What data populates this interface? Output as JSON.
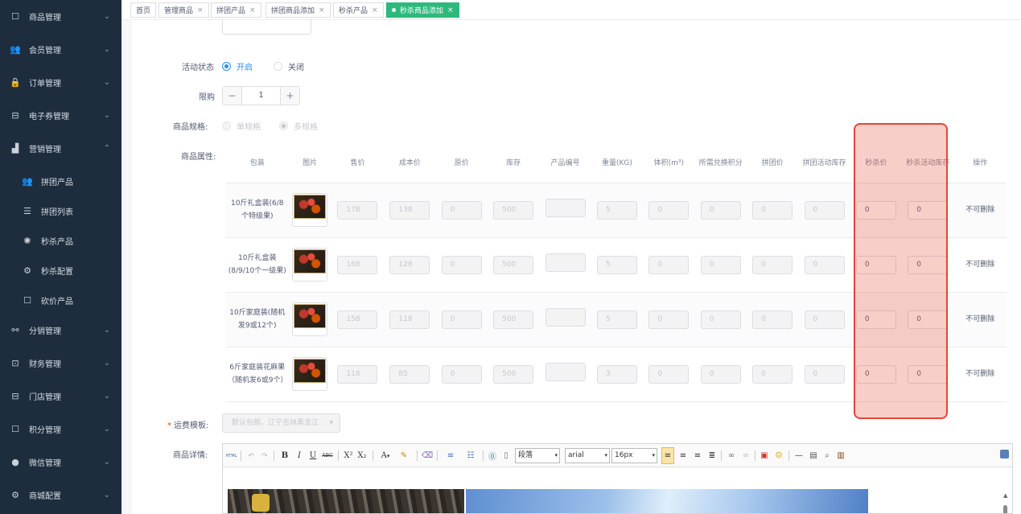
{
  "sidebar": {
    "menu": [
      {
        "label": "商品管理",
        "icon": "box-icon",
        "glyph": "☐",
        "arrow": "⌄"
      },
      {
        "label": "会员管理",
        "icon": "users-icon",
        "glyph": "👥",
        "arrow": "⌄"
      },
      {
        "label": "订单管理",
        "icon": "lock-icon",
        "glyph": "🔒",
        "arrow": "⌄"
      },
      {
        "label": "电子券管理",
        "icon": "coupon-icon",
        "glyph": "⊟",
        "arrow": "⌄"
      },
      {
        "label": "营销管理",
        "icon": "chart-icon",
        "glyph": "▟",
        "arrow": "⌃"
      },
      {
        "label": "分销管理",
        "icon": "share-icon",
        "glyph": "⚯",
        "arrow": "⌄"
      },
      {
        "label": "财务管理",
        "icon": "finance-icon",
        "glyph": "⊡",
        "arrow": "⌄"
      },
      {
        "label": "门店管理",
        "icon": "store-icon",
        "glyph": "⊟",
        "arrow": "⌄"
      },
      {
        "label": "积分管理",
        "icon": "points-icon",
        "glyph": "☐",
        "arrow": "⌄"
      },
      {
        "label": "微信管理",
        "icon": "wechat-icon",
        "glyph": "●",
        "arrow": "⌄"
      },
      {
        "label": "商城配置",
        "icon": "gear-icon",
        "glyph": "⚙",
        "arrow": "⌄"
      }
    ],
    "submenu": [
      {
        "label": "拼团产品",
        "icon": "group-icon",
        "glyph": "👥"
      },
      {
        "label": "拼团列表",
        "icon": "list-icon",
        "glyph": "☰"
      },
      {
        "label": "秒杀产品",
        "icon": "flash-icon",
        "glyph": "✺"
      },
      {
        "label": "秒杀配置",
        "icon": "gear-icon",
        "glyph": "⚙"
      },
      {
        "label": "砍价产品",
        "icon": "cut-icon",
        "glyph": "☐"
      }
    ]
  },
  "tabs": [
    {
      "label": "首页",
      "closable": false
    },
    {
      "label": "管理商品",
      "closable": true
    },
    {
      "label": "拼团产品",
      "closable": true
    },
    {
      "label": "拼团商品添加",
      "closable": true
    },
    {
      "label": "秒杀产品",
      "closable": true
    },
    {
      "label": "秒杀商品添加",
      "closable": true,
      "active": true
    }
  ],
  "tab_close_glyph": "×",
  "form": {
    "status_label": "活动状态",
    "status_on": "开启",
    "status_off": "关闭",
    "limit_label": "限购",
    "limit_value": "1",
    "minus": "−",
    "plus": "+",
    "spec_label": "商品规格:",
    "spec_single": "单规格",
    "spec_multi": "多规格",
    "attr_label": "商品属性:",
    "shipping_label": "运费模板:",
    "shipping_required": "*",
    "shipping_value": "默认包邮，辽宁吉林黑龙江",
    "detail_label": "商品详情:"
  },
  "table": {
    "headers": [
      "包装",
      "图片",
      "售价",
      "成本价",
      "原价",
      "库存",
      "产品编号",
      "重量(KG)",
      "体积(m³)",
      "所需兑换积分",
      "拼团价",
      "拼团活动库存",
      "秒杀价",
      "秒杀活动库存",
      "操作"
    ],
    "rows": [
      {
        "name": "10斤礼盒装(6/8个特级果)",
        "price": "178",
        "cost": "138",
        "original": "0",
        "stock": "500",
        "code": "",
        "weight": "5",
        "volume": "0",
        "points": "0",
        "group_price": "0",
        "group_stock": "0",
        "seckill_price": "0",
        "seckill_stock": "0",
        "op": "不可删除"
      },
      {
        "name": "10斤礼盒装(8/9/10个一级果)",
        "price": "168",
        "cost": "128",
        "original": "0",
        "stock": "500",
        "code": "",
        "weight": "5",
        "volume": "0",
        "points": "0",
        "group_price": "0",
        "group_stock": "0",
        "seckill_price": "0",
        "seckill_stock": "0",
        "op": "不可删除"
      },
      {
        "name": "10斤家庭装(随机发9或12个)",
        "price": "158",
        "cost": "118",
        "original": "0",
        "stock": "500",
        "code": "",
        "weight": "5",
        "volume": "0",
        "points": "0",
        "group_price": "0",
        "group_stock": "0",
        "seckill_price": "0",
        "seckill_stock": "0",
        "op": "不可删除"
      },
      {
        "name": "6斤家庭装花麻果（随机发6或9个）",
        "price": "118",
        "cost": "85",
        "original": "0",
        "stock": "500",
        "code": "",
        "weight": "3",
        "volume": "0",
        "points": "0",
        "group_price": "0",
        "group_stock": "0",
        "seckill_price": "0",
        "seckill_stock": "0",
        "op": "不可删除"
      }
    ]
  },
  "editor": {
    "paragraph": "段落",
    "font": "arial",
    "size": "16px",
    "html_btn": "HTML",
    "bold": "B",
    "italic": "I",
    "underline": "U",
    "strike": "ABC",
    "sup": "X²",
    "sub": "X₂",
    "fontcolor": "A",
    "dropdown_arrow": "▾"
  },
  "colors": {
    "sidebar_bg": "#1e2d3d",
    "active_tab": "#2db97c",
    "primary": "#2d8cf0",
    "highlight": "#e0463a"
  }
}
